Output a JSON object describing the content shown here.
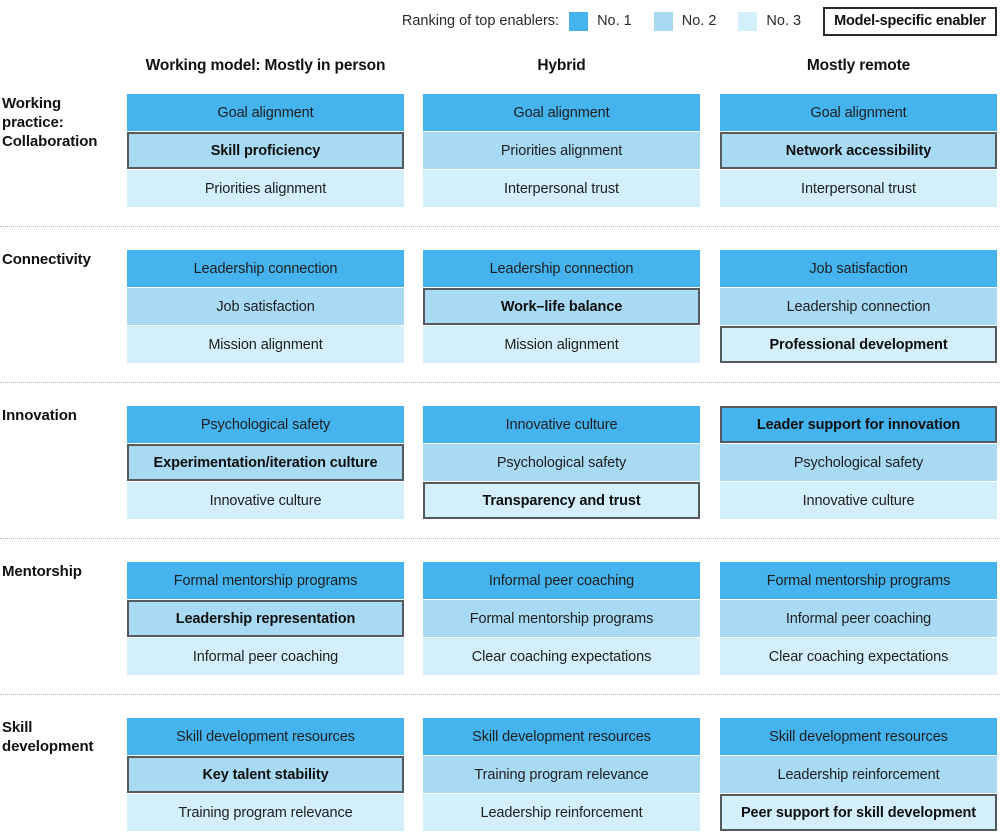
{
  "legend": {
    "label": "Ranking of top enablers:",
    "items": [
      {
        "name": "No. 1",
        "color": "#45b4ee"
      },
      {
        "name": "No. 2",
        "color": "#a8daf4"
      },
      {
        "name": "No. 3",
        "color": "#d3effb"
      }
    ],
    "model_specific_box": "Model-specific enabler"
  },
  "columns": [
    "Working model: Mostly in person",
    "Hybrid",
    "Mostly remote"
  ],
  "rows": [
    {
      "label": "Working practice: Collaboration",
      "columns": [
        [
          {
            "text": "Goal alignment",
            "rank": 1,
            "highlight": false
          },
          {
            "text": "Skill proficiency",
            "rank": 2,
            "highlight": true
          },
          {
            "text": "Priorities alignment",
            "rank": 3,
            "highlight": false
          }
        ],
        [
          {
            "text": "Goal alignment",
            "rank": 1,
            "highlight": false
          },
          {
            "text": "Priorities alignment",
            "rank": 2,
            "highlight": false
          },
          {
            "text": "Interpersonal trust",
            "rank": 3,
            "highlight": false
          }
        ],
        [
          {
            "text": "Goal alignment",
            "rank": 1,
            "highlight": false
          },
          {
            "text": "Network accessibility",
            "rank": 2,
            "highlight": true
          },
          {
            "text": "Interpersonal trust",
            "rank": 3,
            "highlight": false
          }
        ]
      ]
    },
    {
      "label": "Connectivity",
      "columns": [
        [
          {
            "text": "Leadership connection",
            "rank": 1,
            "highlight": false
          },
          {
            "text": "Job satisfaction",
            "rank": 2,
            "highlight": false
          },
          {
            "text": "Mission alignment",
            "rank": 3,
            "highlight": false
          }
        ],
        [
          {
            "text": "Leadership connection",
            "rank": 1,
            "highlight": false
          },
          {
            "text": "Work–life balance",
            "rank": 2,
            "highlight": true
          },
          {
            "text": "Mission alignment",
            "rank": 3,
            "highlight": false
          }
        ],
        [
          {
            "text": "Job satisfaction",
            "rank": 1,
            "highlight": false
          },
          {
            "text": "Leadership connection",
            "rank": 2,
            "highlight": false
          },
          {
            "text": "Professional development",
            "rank": 3,
            "highlight": true
          }
        ]
      ]
    },
    {
      "label": "Innovation",
      "columns": [
        [
          {
            "text": "Psychological safety",
            "rank": 1,
            "highlight": false
          },
          {
            "text": "Experimentation/iteration culture",
            "rank": 2,
            "highlight": true
          },
          {
            "text": "Innovative culture",
            "rank": 3,
            "highlight": false
          }
        ],
        [
          {
            "text": "Innovative culture",
            "rank": 1,
            "highlight": false
          },
          {
            "text": "Psychological safety",
            "rank": 2,
            "highlight": false
          },
          {
            "text": "Transparency and trust",
            "rank": 3,
            "highlight": true
          }
        ],
        [
          {
            "text": "Leader support for innovation",
            "rank": 1,
            "highlight": true
          },
          {
            "text": "Psychological safety",
            "rank": 2,
            "highlight": false
          },
          {
            "text": "Innovative culture",
            "rank": 3,
            "highlight": false
          }
        ]
      ]
    },
    {
      "label": "Mentorship",
      "columns": [
        [
          {
            "text": "Formal mentorship programs",
            "rank": 1,
            "highlight": false
          },
          {
            "text": "Leadership representation",
            "rank": 2,
            "highlight": true
          },
          {
            "text": "Informal peer coaching",
            "rank": 3,
            "highlight": false
          }
        ],
        [
          {
            "text": "Informal peer coaching",
            "rank": 1,
            "highlight": false
          },
          {
            "text": "Formal mentorship programs",
            "rank": 2,
            "highlight": false
          },
          {
            "text": "Clear coaching expectations",
            "rank": 3,
            "highlight": false
          }
        ],
        [
          {
            "text": "Formal mentorship programs",
            "rank": 1,
            "highlight": false
          },
          {
            "text": "Informal peer coaching",
            "rank": 2,
            "highlight": false
          },
          {
            "text": "Clear coaching expectations",
            "rank": 3,
            "highlight": false
          }
        ]
      ]
    },
    {
      "label": "Skill development",
      "columns": [
        [
          {
            "text": "Skill development resources",
            "rank": 1,
            "highlight": false
          },
          {
            "text": "Key talent stability",
            "rank": 2,
            "highlight": true
          },
          {
            "text": "Training program relevance",
            "rank": 3,
            "highlight": false
          }
        ],
        [
          {
            "text": "Skill development resources",
            "rank": 1,
            "highlight": false
          },
          {
            "text": "Training program relevance",
            "rank": 2,
            "highlight": false
          },
          {
            "text": "Leadership reinforcement",
            "rank": 3,
            "highlight": false
          }
        ],
        [
          {
            "text": "Skill development resources",
            "rank": 1,
            "highlight": false
          },
          {
            "text": "Leadership reinforcement",
            "rank": 2,
            "highlight": false
          },
          {
            "text": "Peer support for skill development",
            "rank": 3,
            "highlight": true
          }
        ]
      ]
    }
  ]
}
